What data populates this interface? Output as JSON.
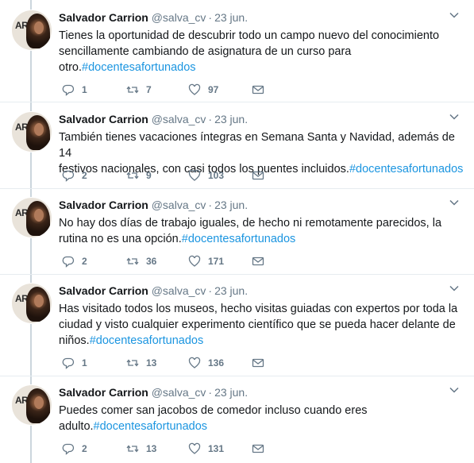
{
  "tweets": [
    {
      "name": "Salvador Carrion",
      "handle": "@salva_cv",
      "separator": "·",
      "time": "23 jun.",
      "lines": [
        "Tienes la oportunidad de descubrir todo un campo nuevo del conocimiento",
        "sencillamente cambiando de asignatura de un curso para"
      ],
      "last_line_text": "otro.",
      "hashtag": "#docentesafortunados",
      "replies": "1",
      "retweets": "7",
      "likes": "97"
    },
    {
      "name": "Salvador Carrion",
      "handle": "@salva_cv",
      "separator": "·",
      "time": "23 jun.",
      "lines": [
        "También tienes vacaciones íntegras en Semana Santa y Navidad, además de 14"
      ],
      "last_line_text": "festivos nacionales, con casi todos los puentes incluidos.",
      "hashtag": "#docentesafortunados",
      "replies": "2",
      "retweets": "9",
      "likes": "103"
    },
    {
      "name": "Salvador Carrion",
      "handle": "@salva_cv",
      "separator": "·",
      "time": "23 jun.",
      "lines": [
        "No hay dos días de trabajo iguales, de hecho ni remotamente parecidos, la"
      ],
      "last_line_text": "rutina no es una opción.",
      "hashtag": "#docentesafortunados",
      "replies": "2",
      "retweets": "36",
      "likes": "171"
    },
    {
      "name": "Salvador Carrion",
      "handle": "@salva_cv",
      "separator": "·",
      "time": "23 jun.",
      "lines": [
        "Has visitado todos los museos, hecho visitas guiadas con expertos por toda la",
        "ciudad y visto cualquier experimento científico que se pueda hacer delante de"
      ],
      "last_line_text": "niños.",
      "hashtag": "#docentesafortunados",
      "replies": "1",
      "retweets": "13",
      "likes": "136"
    },
    {
      "name": "Salvador Carrion",
      "handle": "@salva_cv",
      "separator": "·",
      "time": "23 jun.",
      "lines": [
        "Puedes comer san jacobos de comedor incluso cuando eres"
      ],
      "last_line_text": "adulto.",
      "hashtag": "#docentesafortunados",
      "replies": "2",
      "retweets": "13",
      "likes": "131"
    }
  ],
  "avatar_letters": "AR",
  "colors": {
    "text": "#14171a",
    "secondary": "#657786",
    "hashtag": "#1b95e0",
    "thread_line": "#ccd6dd",
    "divider": "#e6ecf0"
  },
  "icons": {
    "reply": "reply-icon",
    "retweet": "retweet-icon",
    "like": "heart-icon",
    "dm": "envelope-icon",
    "menu": "chevron-down-icon"
  }
}
